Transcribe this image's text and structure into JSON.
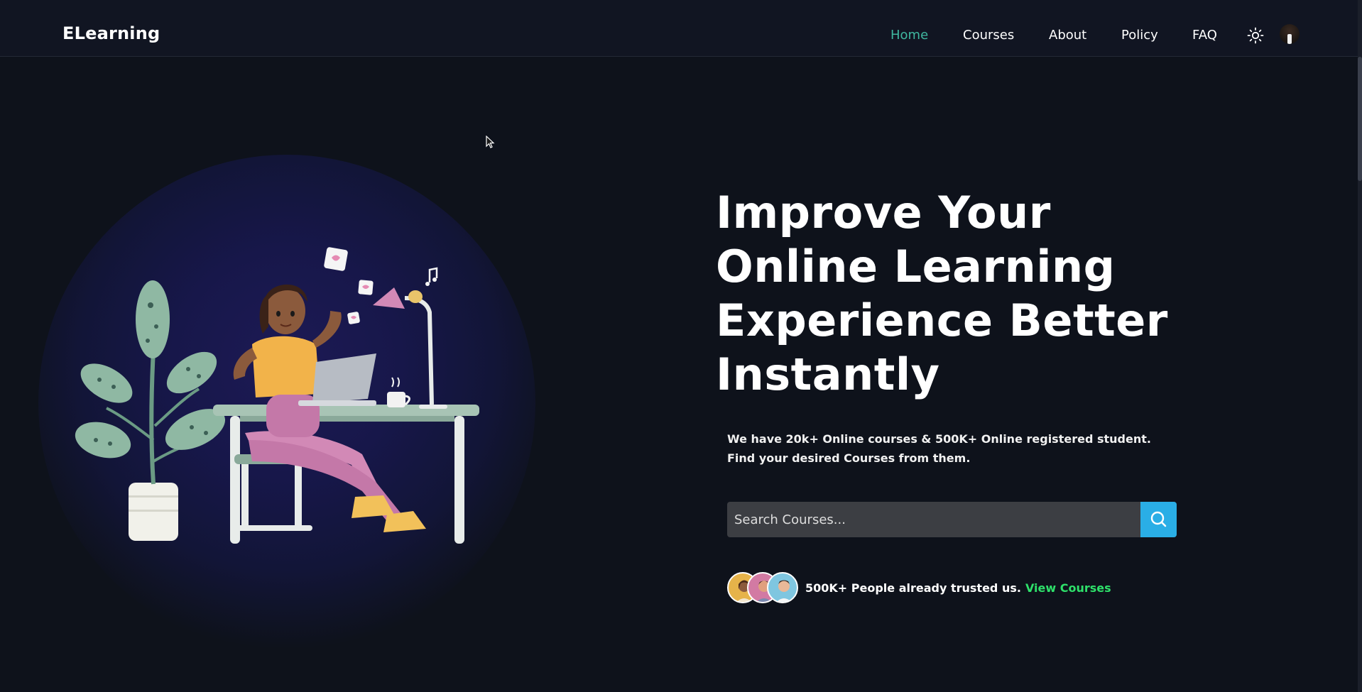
{
  "navbar": {
    "logo": "ELearning",
    "links": [
      {
        "label": "Home",
        "active": true
      },
      {
        "label": "Courses",
        "active": false
      },
      {
        "label": "About",
        "active": false
      },
      {
        "label": "Policy",
        "active": false
      },
      {
        "label": "FAQ",
        "active": false
      }
    ],
    "theme_toggle_icon": "sun-icon",
    "profile_icon": "user-avatar"
  },
  "hero": {
    "headline_lines": [
      "Improve Your",
      "Online Learning",
      "Experience Better",
      "Instantly"
    ],
    "subtext": "We have 20k+ Online courses & 500K+ Online registered student. Find your desired Courses from them.",
    "search": {
      "placeholder": "Search Courses...",
      "value": "",
      "button_icon": "search-icon"
    },
    "trust": {
      "text": "500K+ People already trusted us.",
      "link": "View Courses",
      "avatar_count": 3
    },
    "illustration": "woman-at-desk-with-laptop-illustration"
  },
  "colors": {
    "background": "#0e121b",
    "navbar": "#111522",
    "active_link": "#3fb7a0",
    "search_button": "#2aaee6",
    "trust_link": "#2ee06a",
    "glow": "#1d1a55"
  }
}
